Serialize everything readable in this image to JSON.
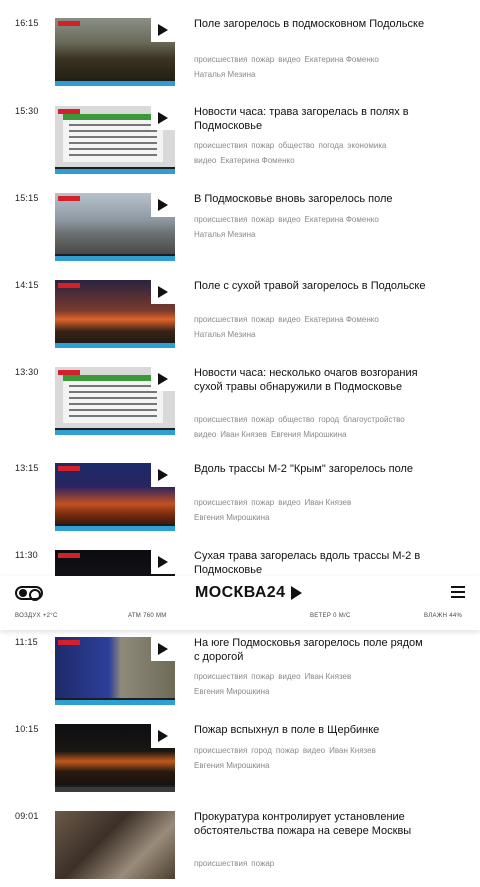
{
  "news": [
    {
      "time": "16:15",
      "title": "Поле загорелось в подмосковном Подольске",
      "tags": [
        "происшествия",
        "пожар",
        "видео",
        "Екатерина Фоменко",
        "Наталья Мезина"
      ]
    },
    {
      "time": "15:30",
      "title": "Новости часа: трава загорелась в полях в Подмосковье",
      "tags": [
        "происшествия",
        "пожар",
        "общество",
        "погода",
        "экономика",
        "видео",
        "Екатерина Фоменко"
      ]
    },
    {
      "time": "15:15",
      "title": "В Подмосковье вновь загорелось поле",
      "tags": [
        "происшествия",
        "пожар",
        "видео",
        "Екатерина Фоменко",
        "Наталья Мезина"
      ]
    },
    {
      "time": "14:15",
      "title": "Поле с сухой травой загорелось в Подольске",
      "tags": [
        "происшествия",
        "пожар",
        "видео",
        "Екатерина Фоменко",
        "Наталья Мезина"
      ]
    },
    {
      "time": "13:30",
      "title": "Новости часа: несколько очагов возгорания сухой травы обнаружили в Подмосковье",
      "tags": [
        "происшествия",
        "пожар",
        "общество",
        "город",
        "благоустройство",
        "видео",
        "Иван Князев",
        "Евгения Мирошкина"
      ]
    },
    {
      "time": "13:15",
      "title": "Вдоль трассы М-2 \"Крым\" загорелось поле",
      "tags": [
        "происшествия",
        "пожар",
        "видео",
        "Иван Князев",
        "Евгения Мирошкина"
      ]
    },
    {
      "time": "11:30",
      "title": "Сухая трава загорелась вдоль трассы М-2 в Подмосковье",
      "tags": []
    },
    {
      "time": "11:15",
      "title": "На юге Подмосковья загорелось поле рядом с дорогой",
      "tags": [
        "происшествия",
        "пожар",
        "видео",
        "Иван Князев",
        "Евгения Мирошкина"
      ]
    },
    {
      "time": "10:15",
      "title": "Пожар вспыхнул в поле в Щербинке",
      "tags": [
        "происшествия",
        "город",
        "пожар",
        "видео",
        "Иван Князев",
        "Евгения Мирошкина"
      ]
    },
    {
      "time": "09:01",
      "title": "Прокуратура контролирует установление обстоятельства пожара на севере Москвы",
      "tags": [
        "происшествия",
        "пожар"
      ]
    }
  ],
  "header": {
    "logo": "МОСКВА24",
    "weather": "ВОЗДУХ +2°C",
    "pressure": "АТМ 760 ММ",
    "wind": "ВЕТЕР 0 М/С",
    "humidity": "ВЛАЖН 44%"
  },
  "icons": {
    "theme_toggle": "toggle-icon",
    "logo_arrow": "play-triangle-icon",
    "menu": "hamburger-icon",
    "play": "play-icon"
  },
  "colors": {
    "accent_strip": "#2f9fd1",
    "badge_red": "#d4202a"
  }
}
